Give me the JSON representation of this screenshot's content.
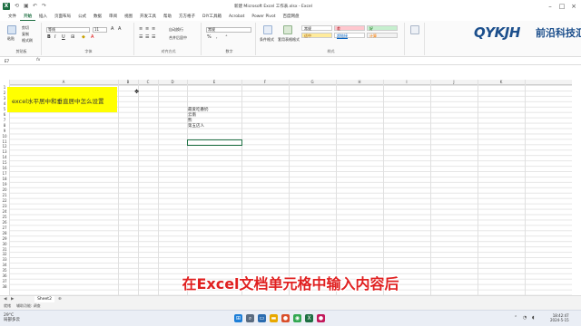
{
  "window": {
    "title": "新建 Microsoft Excel 工作表.xlsx  -  Excel",
    "file_label": "文件"
  },
  "ribbon_tabs": [
    "文件",
    "开始",
    "插入",
    "页面布局",
    "公式",
    "数据",
    "审阅",
    "视图",
    "开发工具",
    "帮助",
    "方方格子",
    "DIY工具箱",
    "Acrobat",
    "Power Pivot",
    "百度网盘"
  ],
  "active_tab": "开始",
  "ribbon": {
    "clipboard": {
      "paste": "粘贴",
      "cut": "剪切",
      "copy": "复制",
      "format_painter": "格式刷",
      "label": "剪贴板"
    },
    "font": {
      "name": "等线",
      "size": "11",
      "label": "字体"
    },
    "alignment": {
      "wrap": "自动换行",
      "merge": "合并后居中",
      "label": "对齐方式"
    },
    "number": {
      "format": "常规",
      "label": "数字"
    },
    "styles": {
      "conditional": "条件格式",
      "table_format": "套用表格格式",
      "cells": [
        "常规",
        "差",
        "好",
        "适中",
        "超链接",
        "计算"
      ],
      "label": "样式"
    }
  },
  "watermark": {
    "en": "QYKJH",
    "cn": "前沿科技汇"
  },
  "formula_bar": {
    "name_box": "E7",
    "fx": "fx"
  },
  "columns": [
    "A",
    "B",
    "C",
    "D",
    "E",
    "F",
    "G",
    "H",
    "I",
    "J",
    "K"
  ],
  "rows": [
    "1",
    "2",
    "3",
    "4",
    "5",
    "6",
    "7",
    "8",
    "9",
    "10",
    "11",
    "12",
    "13",
    "14",
    "15",
    "16",
    "17",
    "18",
    "19",
    "20",
    "21",
    "22",
    "23",
    "24",
    "25",
    "26",
    "27",
    "28",
    "29",
    "30",
    "31",
    "32",
    "33",
    "34",
    "35",
    "36",
    "37",
    "38"
  ],
  "cells": {
    "yellow_note": "excel水平居中和垂直居中怎么设置",
    "e1": "最爱吃番奶",
    "e2": "云南",
    "e3": "熊",
    "e4": "第五店人"
  },
  "sheet_tab": "Sheet2",
  "status": {
    "ready": "就绪",
    "accessibility": "辅助功能: 调查"
  },
  "subtitle": "在Excel文档单元格中输入内容后",
  "taskbar": {
    "weather_temp": "29°C",
    "weather_desc": "局部多云",
    "time": "18:42:47",
    "date": "2024-5-15"
  },
  "colors": {
    "excel_green": "#217346",
    "highlight_yellow": "#ffff00",
    "subtitle_red": "#e02020",
    "watermark_blue": "#1c4f8c"
  }
}
